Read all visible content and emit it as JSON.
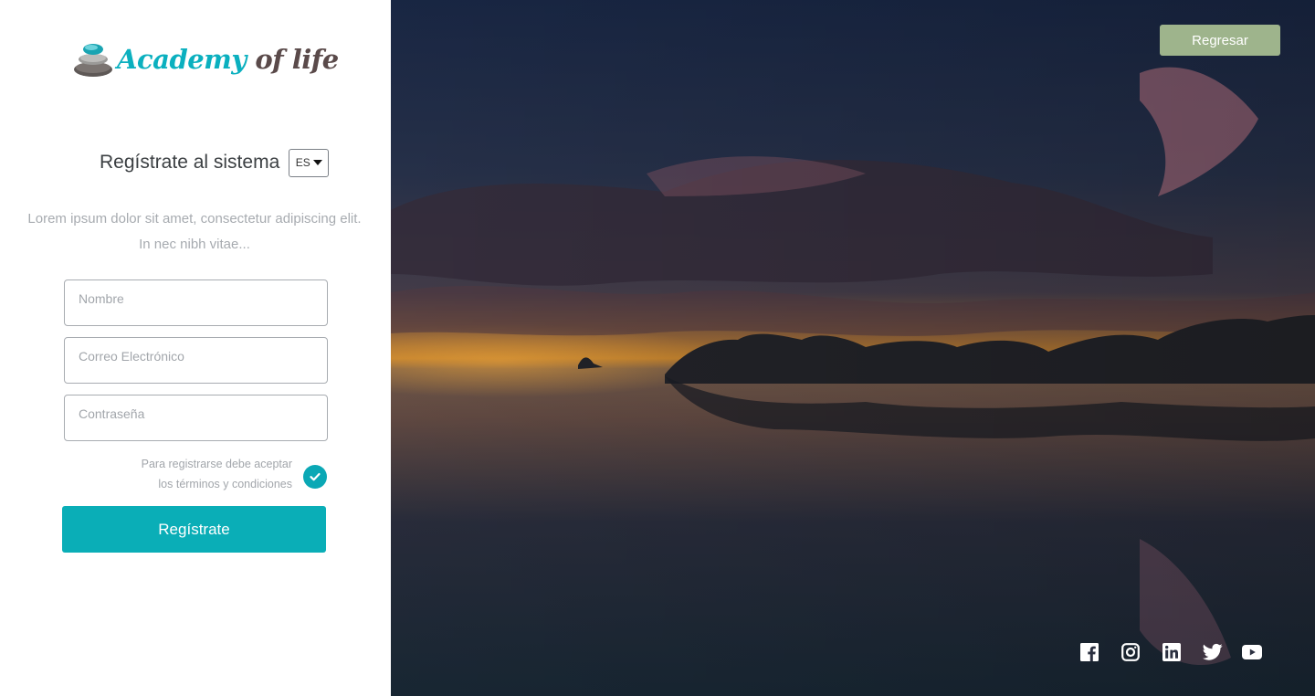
{
  "brand": {
    "part1": "Academy",
    "part2": "of life"
  },
  "register": {
    "title": "Regístrate al sistema",
    "language": "ES",
    "description": "Lorem ipsum dolor sit amet, consectetur adipiscing elit. In nec nibh vitae...",
    "name_placeholder": "Nombre",
    "email_placeholder": "Correo Electrónico",
    "password_placeholder": "Contraseña",
    "terms_line1": "Para registrarse debe aceptar",
    "terms_line2": "los términos y condiciones",
    "submit_label": "Regístrate"
  },
  "hero": {
    "back_label": "Regresar"
  },
  "social": {
    "icons": [
      "facebook-icon",
      "instagram-icon",
      "linkedin-icon",
      "twitter-icon",
      "youtube-icon"
    ]
  },
  "colors": {
    "accent": "#0aaeb7",
    "back_button": "#9eb48c",
    "brand_secondary": "#5a4a4a"
  }
}
